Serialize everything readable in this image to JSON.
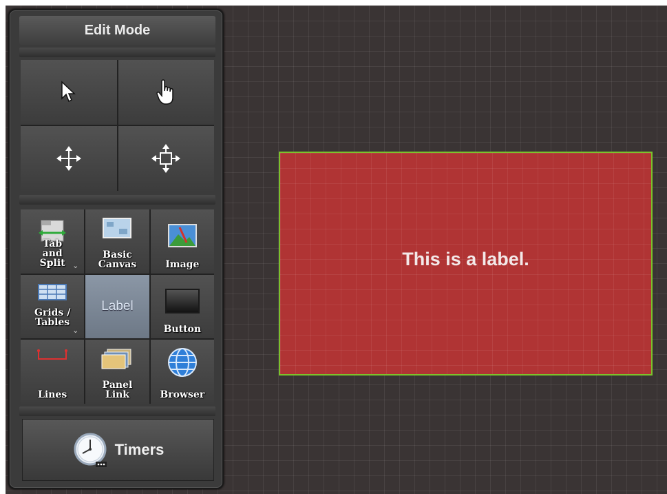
{
  "panel": {
    "title": "Edit Mode",
    "mode_tools": [
      {
        "name": "select-tool",
        "icon": "arrow-pointer-icon"
      },
      {
        "name": "hand-tool",
        "icon": "hand-pointer-icon"
      },
      {
        "name": "move-tool",
        "icon": "move-arrows-icon"
      },
      {
        "name": "resize-tool",
        "icon": "resize-arrows-icon"
      }
    ],
    "tools": {
      "tab_split": "Tab and Split",
      "tab_split_lines": [
        "Tab",
        "and",
        "Split"
      ],
      "basic_canvas_lines": [
        "Basic",
        "Canvas"
      ],
      "image": "Image",
      "grids_tables_lines": [
        "Grids /",
        "Tables"
      ],
      "label": "Label",
      "button": "Button",
      "lines": "Lines",
      "panel_link_lines": [
        "Panel",
        "Link"
      ],
      "browser": "Browser"
    },
    "selected_tool": "Label",
    "timers": "Timers"
  },
  "canvas": {
    "label_text": "This is a label.",
    "label_color": "#b03434",
    "selection_border_color": "#7cc12c",
    "background_color": "#3a3434"
  }
}
